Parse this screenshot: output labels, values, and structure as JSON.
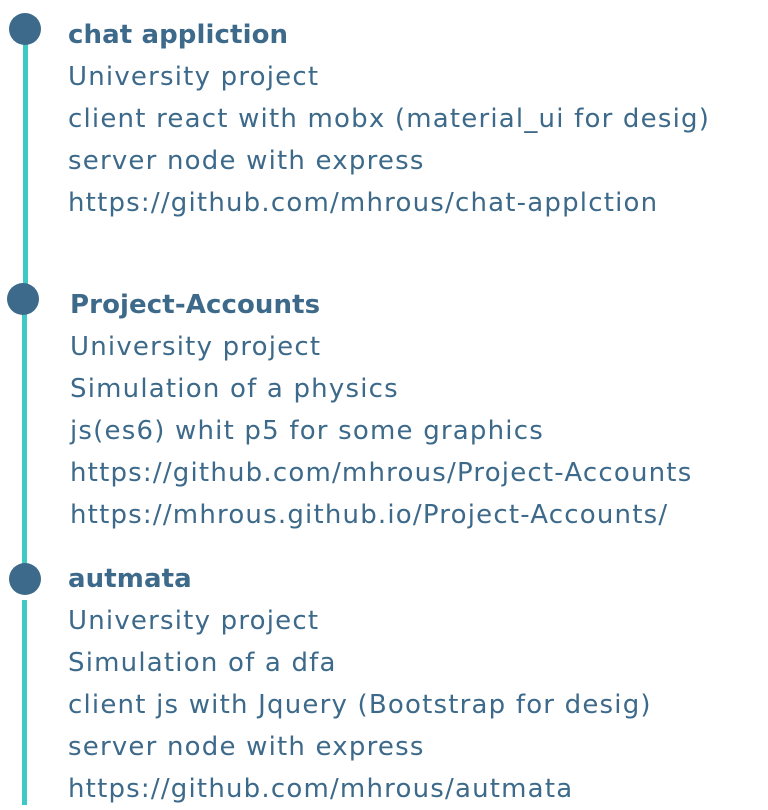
{
  "projects": [
    {
      "title": "chat appliction",
      "lines": [
        "University project",
        "client react with mobx (material_ui for desig)",
        "server node with express",
        "https://github.com/mhrous/chat-applction"
      ]
    },
    {
      "title": "Project-Accounts",
      "lines": [
        "University project",
        "Simulation of a physics",
        "js(es6) whit p5 for some graphics",
        "https://github.com/mhrous/Project-Accounts",
        "https://mhrous.github.io/Project-Accounts/"
      ]
    },
    {
      "title": "autmata",
      "lines": [
        "University project",
        "Simulation of a dfa",
        "client js with Jquery  (Bootstrap for desig)",
        "server node with express",
        "https://github.com/mhrous/autmata"
      ]
    }
  ],
  "colors": {
    "dot": "#3d6a8a",
    "line": "#3ec9c4",
    "text": "#3d6a8a"
  }
}
